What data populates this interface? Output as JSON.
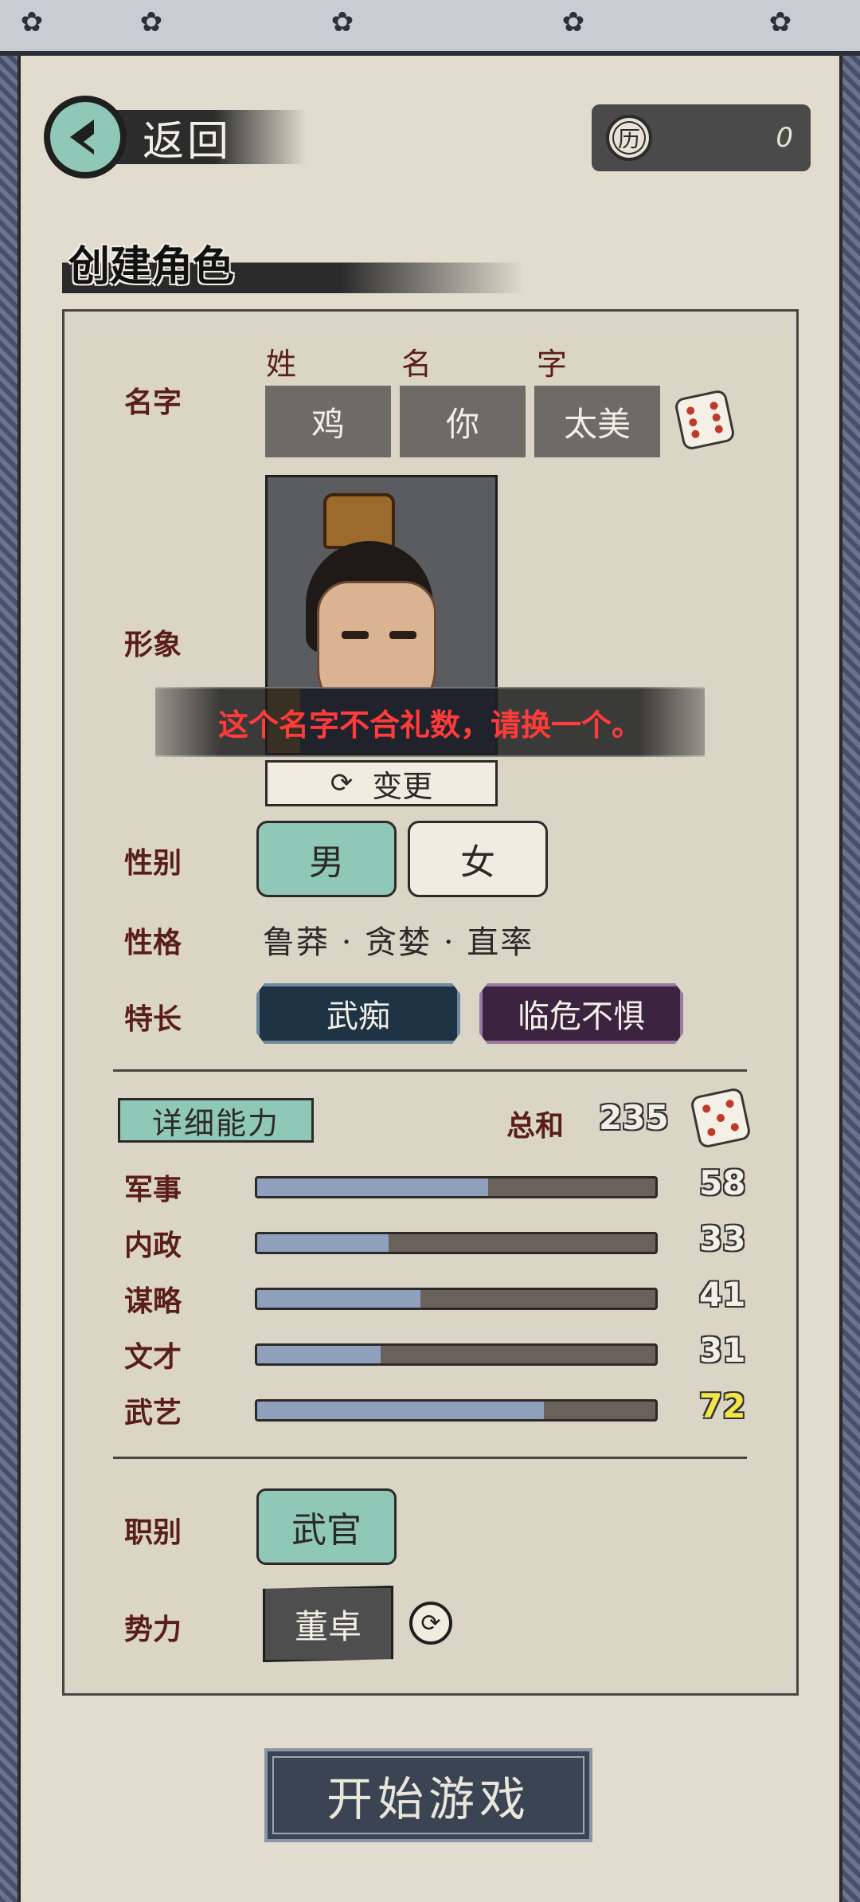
{
  "header": {
    "back_label": "返回",
    "currency_icon_glyph": "历",
    "currency_value": "0"
  },
  "page_title": "创建角色",
  "name": {
    "row_label": "名字",
    "surname_label": "姓",
    "given_label": "名",
    "courtesy_label": "字",
    "surname_value": "鸡",
    "given_value": "你",
    "courtesy_value": "太美"
  },
  "portrait": {
    "row_label": "形象",
    "change_label": "变更"
  },
  "toast": "这个名字不合礼数，请换一个。",
  "gender": {
    "row_label": "性别",
    "male": "男",
    "female": "女",
    "selected": "男"
  },
  "personality": {
    "row_label": "性格",
    "value": "鲁莽 · 贪婪 · 直率"
  },
  "specialty": {
    "row_label": "特长",
    "items": [
      "武痴",
      "临危不惧"
    ]
  },
  "abilities": {
    "detail_label": "详细能力",
    "sum_label": "总和",
    "sum_value": "235",
    "stats": [
      {
        "label": "军事",
        "value": 58,
        "max": 100
      },
      {
        "label": "内政",
        "value": 33,
        "max": 100
      },
      {
        "label": "谋略",
        "value": 41,
        "max": 100
      },
      {
        "label": "文才",
        "value": 31,
        "max": 100
      },
      {
        "label": "武艺",
        "value": 72,
        "max": 100
      }
    ]
  },
  "job": {
    "row_label": "职别",
    "value": "武官"
  },
  "faction": {
    "row_label": "势力",
    "value": "董卓"
  },
  "start_button": "开始游戏",
  "icons": {
    "back": "back-arrow-icon",
    "currency": "coin-icon",
    "dice": "dice-icon",
    "refresh": "refresh-icon"
  },
  "colors": {
    "accent_green": "#8fc8b6",
    "label_red": "#5a1e18",
    "warning_red": "#ff3b3b",
    "highlight_yellow": "#f4e64a"
  }
}
